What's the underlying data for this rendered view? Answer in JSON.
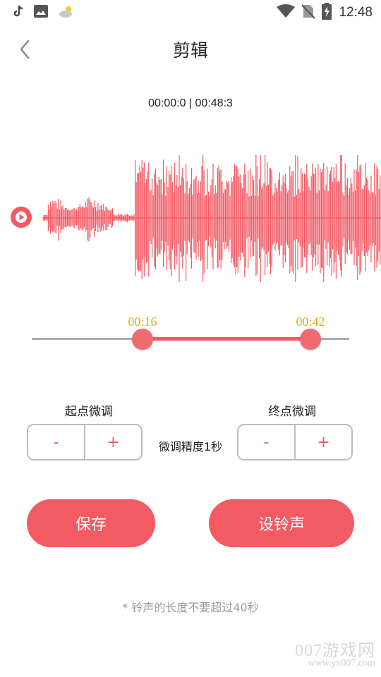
{
  "status_bar": {
    "time": "12:48",
    "left_icons": [
      "tiktok-icon",
      "gallery-icon",
      "weather-icon"
    ],
    "right_icons": [
      "wifi-icon",
      "no-sim-icon",
      "battery-charging-icon"
    ]
  },
  "header": {
    "title": "剪辑",
    "back_icon": "chevron-left-icon"
  },
  "player": {
    "timecode": "00:00:0 | 00:48:3",
    "play_icon": "play-icon",
    "wave_color": "#f25a64"
  },
  "range": {
    "start_label": "00:16",
    "end_label": "00:42",
    "start_fraction": 0.35,
    "end_fraction": 0.88,
    "accent": "#f25a64",
    "label_color": "#e6a817"
  },
  "fine_tune": {
    "start_title": "起点微调",
    "end_title": "终点微调",
    "minus": "-",
    "plus": "+",
    "precision": "微调精度1秒"
  },
  "actions": {
    "save": "保存",
    "set_ringtone": "设铃声"
  },
  "note": "* 铃声的长度不要超过40秒",
  "watermark": {
    "brand": "007游戏网",
    "url": "www.yx007.com"
  }
}
